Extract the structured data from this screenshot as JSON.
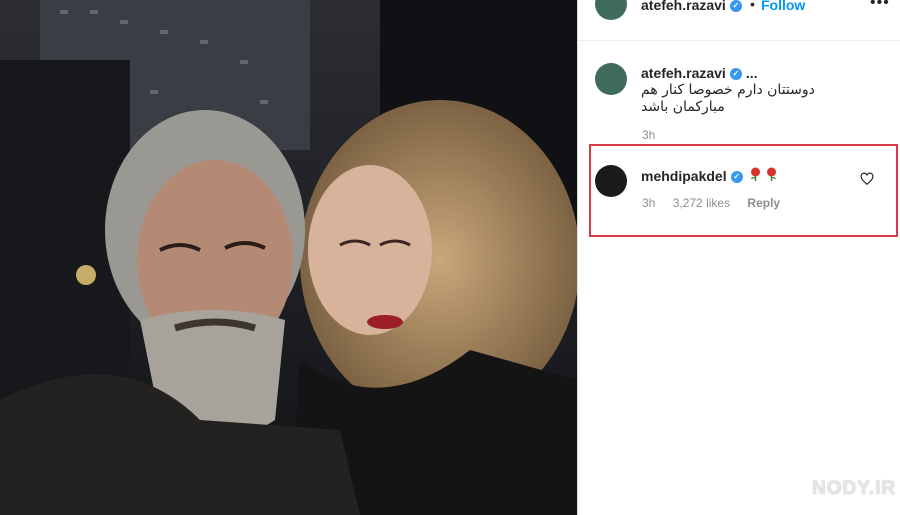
{
  "header": {
    "username": "atefeh.razavi",
    "separator": "•",
    "follow_label": "Follow",
    "more_label": "•••"
  },
  "caption": {
    "username": "atefeh.razavi",
    "ellipsis": "...",
    "text_line1": "دوستتان دارم خصوصا کنار هم",
    "text_line2": "مبارکمان باشد",
    "time": "3h"
  },
  "comment": {
    "username": "mehdipakdel",
    "emoji_icons": "rose-icon rose-icon",
    "time": "3h",
    "likes": "3,272 likes",
    "reply_label": "Reply"
  },
  "verified_icon": "✓",
  "watermark": {
    "text": "NODY.IR"
  },
  "colors": {
    "link_blue": "#0095f6",
    "verified_blue": "#3897f0",
    "highlight_red": "#d63a44",
    "muted_gray": "#8e8e8e"
  }
}
